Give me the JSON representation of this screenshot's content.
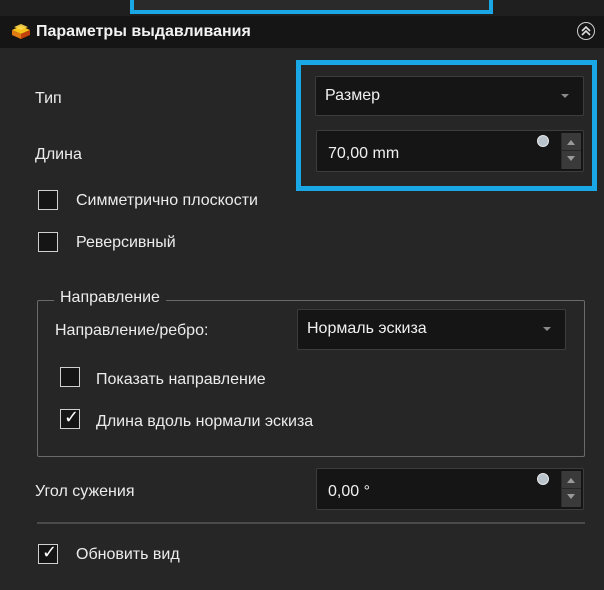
{
  "title": "Параметры выдавливания",
  "colors": {
    "highlight": "#1aa7e6",
    "panel_bg": "#262626",
    "field_bg": "#151515"
  },
  "type_row": {
    "label": "Тип",
    "value": "Размер"
  },
  "length_row": {
    "label": "Длина",
    "value": "70,00 mm"
  },
  "symmetric": {
    "label": "Симметрично плоскости",
    "checked": false
  },
  "reverse": {
    "label": "Реверсивный",
    "checked": false
  },
  "direction_group": {
    "title": "Направление",
    "edge_label": "Направление/ребро:",
    "edge_value": "Нормаль эскиза",
    "show_direction": {
      "label": "Показать направление",
      "checked": false
    },
    "length_along_normal": {
      "label": "Длина вдоль нормали эскиза",
      "checked": true
    }
  },
  "taper_row": {
    "label": "Угол сужения",
    "value": "0,00 °"
  },
  "update_view": {
    "label": "Обновить вид",
    "checked": true
  },
  "check_mark": "✓",
  "icons": [
    "extrude-icon",
    "collapse-icon",
    "dropdown-arrow-icon",
    "calculator-icon",
    "spin-up-icon",
    "spin-down-icon"
  ]
}
